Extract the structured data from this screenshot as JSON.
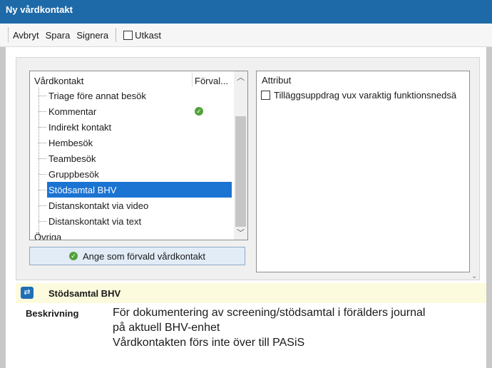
{
  "window": {
    "title": "Ny vårdkontakt"
  },
  "toolbar": {
    "cancel_label": "Avbryt",
    "save_label": "Spara",
    "sign_label": "Signera",
    "draft_label": "Utkast",
    "draft_checked": false
  },
  "tree": {
    "col_name": "Vårdkontakt",
    "col_default": "Förval...",
    "items": [
      {
        "label": "Triage före annat besök"
      },
      {
        "label": "Kommentar",
        "default_icon": "check-circle-icon"
      },
      {
        "label": "Indirekt kontakt"
      },
      {
        "label": "Hembesök"
      },
      {
        "label": "Teambesök"
      },
      {
        "label": "Gruppbesök"
      },
      {
        "label": "Stödsamtal BHV",
        "selected": true
      },
      {
        "label": "Distanskontakt via video"
      },
      {
        "label": "Distanskontakt via text"
      }
    ],
    "root_item": "Övriga"
  },
  "set_default_button": {
    "label": "Ange som förvald vårdkontakt"
  },
  "attributes": {
    "title": "Attribut",
    "items": [
      {
        "label": "Tilläggsuppdrag vux varaktig funktionsnedsä",
        "checked": false
      }
    ]
  },
  "info": {
    "title": "Stödsamtal BHV",
    "description_label": "Beskrivning",
    "description_lines": [
      "För dokumentering av screening/stödsamtal i förälders journal",
      "på aktuell BHV-enhet",
      "Vårdkontakten förs inte över till PASiS"
    ]
  },
  "colors": {
    "title_bar": "#1e6aa8",
    "selection": "#1b73d2",
    "check_green": "#52a23b",
    "info_bg": "#fdfbdd"
  }
}
